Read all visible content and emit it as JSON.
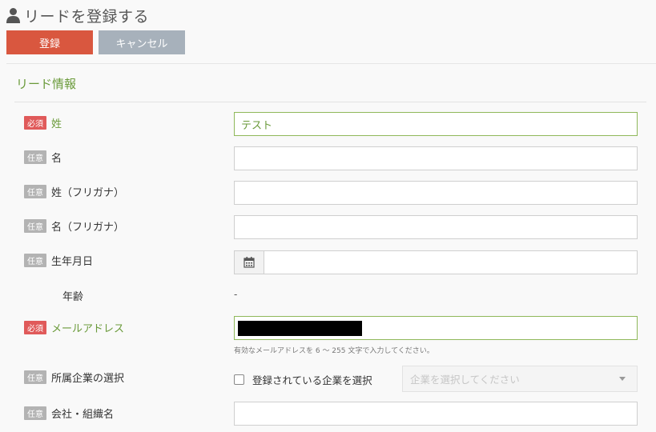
{
  "page": {
    "title": "リードを登録する",
    "icon": "user-icon"
  },
  "actions": {
    "save_label": "登録",
    "cancel_label": "キャンセル"
  },
  "section": {
    "title": "リード情報"
  },
  "badges": {
    "required": "必須",
    "optional": "任意"
  },
  "fields": {
    "last_name": {
      "label": "姓",
      "value": "テスト"
    },
    "first_name": {
      "label": "名",
      "value": ""
    },
    "last_name_kana": {
      "label": "姓（フリガナ）",
      "value": ""
    },
    "first_name_kana": {
      "label": "名（フリガナ）",
      "value": ""
    },
    "birthdate": {
      "label": "生年月日",
      "value": "",
      "icon": "calendar-icon"
    },
    "age": {
      "label": "年齢",
      "value": "-"
    },
    "email": {
      "label": "メールアドレス",
      "help": "有効なメールアドレスを 6 ～ 255 文字で入力してください。"
    },
    "company_select": {
      "label": "所属企業の選択",
      "checkbox_label": "登録されている企業を選択",
      "placeholder": "企業を選択してください"
    },
    "company_name": {
      "label": "会社・組織名",
      "value": ""
    }
  },
  "colors": {
    "save": "#d9573f",
    "cancel": "#a7b1bb",
    "required": "#e05a5a",
    "optional": "#b3b3b3",
    "accent": "#6a9a3a"
  }
}
